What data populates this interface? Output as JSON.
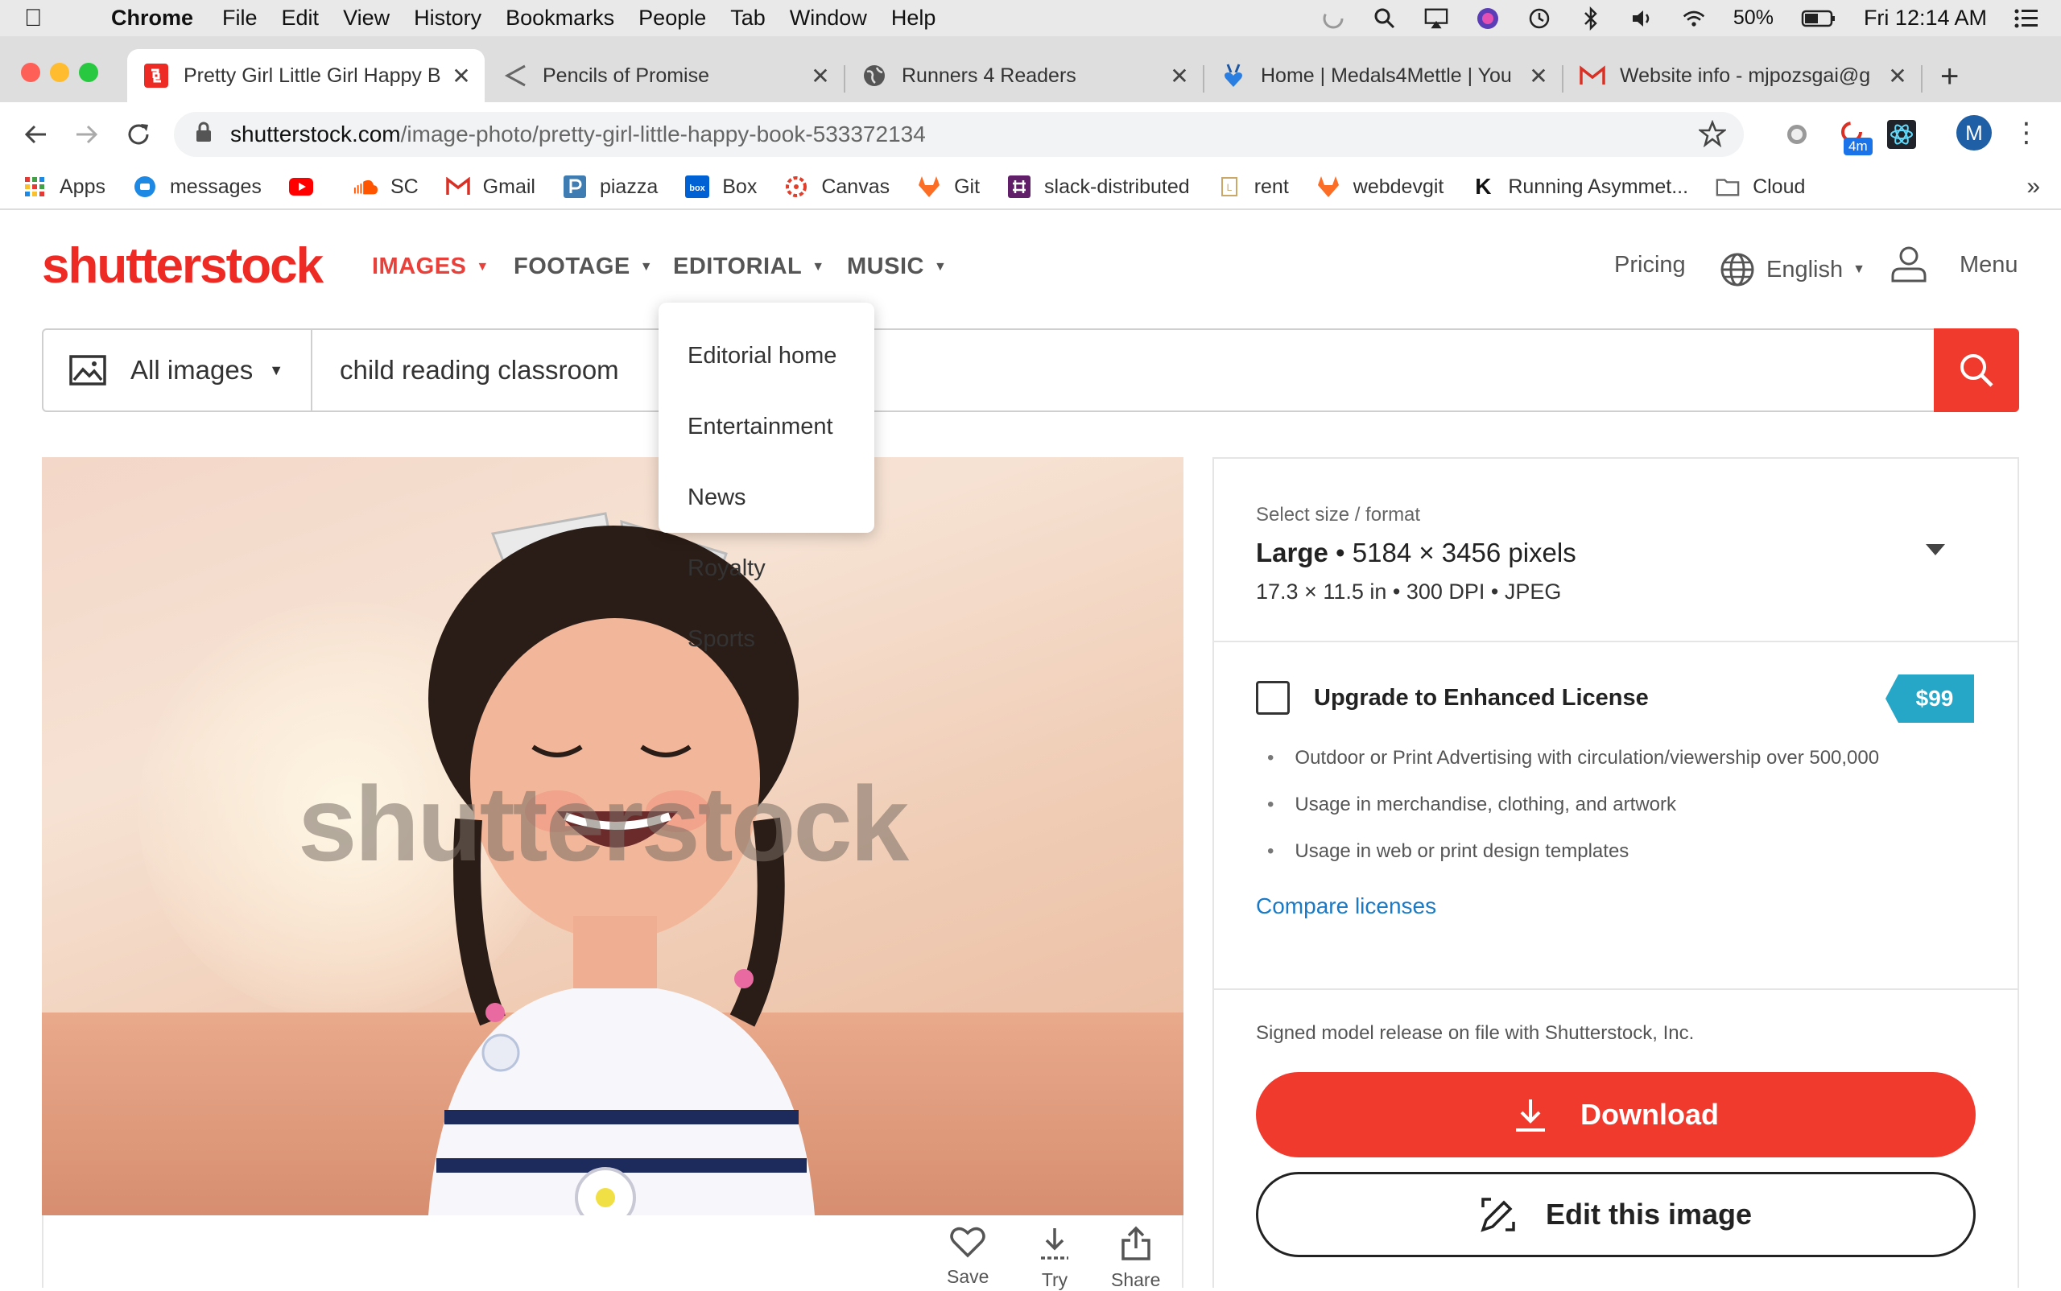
{
  "macos": {
    "app": "Chrome",
    "menus": [
      "File",
      "Edit",
      "View",
      "History",
      "Bookmarks",
      "People",
      "Tab",
      "Window",
      "Help"
    ],
    "battery": "50%",
    "clock": "Fri 12:14 AM"
  },
  "tabs": [
    {
      "title": "Pretty Girl Little Girl Happy B",
      "favicon": "shutterstock-icon",
      "active": true
    },
    {
      "title": "Pencils of Promise",
      "favicon": "back-arrow-icon"
    },
    {
      "title": "Runners 4 Readers",
      "favicon": "globe-icon"
    },
    {
      "title": "Home | Medals4Mettle | You",
      "favicon": "medal-heart-icon"
    },
    {
      "title": "Website info - mjpozsgai@g",
      "favicon": "gmail-icon"
    }
  ],
  "address": {
    "host": "shutterstock.com",
    "path": "/image-photo/pretty-girl-little-happy-book-533372134"
  },
  "profile_initial": "M",
  "extension_badge": "4m",
  "bookmarks": [
    {
      "label": "Apps",
      "icon": "apps-grid-icon",
      "color": "#e53935"
    },
    {
      "label": "messages",
      "icon": "messages-icon",
      "color": "#1e88e5"
    },
    {
      "label": "",
      "icon": "youtube-icon",
      "color": "#ff0000"
    },
    {
      "label": "SC",
      "icon": "soundcloud-icon",
      "color": "#ff5500"
    },
    {
      "label": "Gmail",
      "icon": "gmail-icon",
      "color": "#d93025"
    },
    {
      "label": "piazza",
      "icon": "piazza-icon",
      "color": "#3e7cb1"
    },
    {
      "label": "Box",
      "icon": "box-icon",
      "color": "#0061d5"
    },
    {
      "label": "Canvas",
      "icon": "canvas-icon",
      "color": "#e13f2b"
    },
    {
      "label": "Git",
      "icon": "gitlab-icon",
      "color": "#fc6d26"
    },
    {
      "label": "slack-distributed",
      "icon": "slack-icon",
      "color": "#611f69"
    },
    {
      "label": "rent",
      "icon": "rent-icon",
      "color": "#c9a86a"
    },
    {
      "label": "webdevgit",
      "icon": "gitlab-icon",
      "color": "#fc6d26"
    },
    {
      "label": "Running Asymmet...",
      "icon": "k-icon",
      "color": "#111111"
    },
    {
      "label": "Cloud",
      "icon": "folder-icon",
      "color": "#777777"
    }
  ],
  "site": {
    "logo": "shutterstock",
    "nav": [
      "IMAGES",
      "FOOTAGE",
      "EDITORIAL",
      "MUSIC"
    ],
    "pricing": "Pricing",
    "language": "English",
    "menu": "Menu",
    "search_type": "All images",
    "search_query": "child reading classroom",
    "editorial_menu": [
      "Editorial home",
      "Entertainment",
      "News",
      "Royalty",
      "Sports"
    ],
    "watermark": "shutterstock",
    "photo_actions": [
      "Save",
      "Try",
      "Share"
    ]
  },
  "panel": {
    "size_label": "Select size / format",
    "size_name": "Large",
    "size_pixels": "• 5184 × 3456 pixels",
    "size_detail": "17.3 × 11.5 in • 300 DPI • JPEG",
    "upgrade_title": "Upgrade to Enhanced License",
    "upgrade_price": "$99",
    "upgrade_benefits": [
      "Outdoor or Print Advertising with circulation/viewership over 500,000",
      "Usage in merchandise, clothing, and artwork",
      "Usage in web or print design templates"
    ],
    "compare": "Compare licenses",
    "release": "Signed model release on file with Shutterstock, Inc.",
    "download": "Download",
    "edit": "Edit this image"
  },
  "colors": {
    "brand_red": "#ee2a24",
    "link_blue": "#1a7ac6",
    "price_teal": "#27a7c7"
  }
}
